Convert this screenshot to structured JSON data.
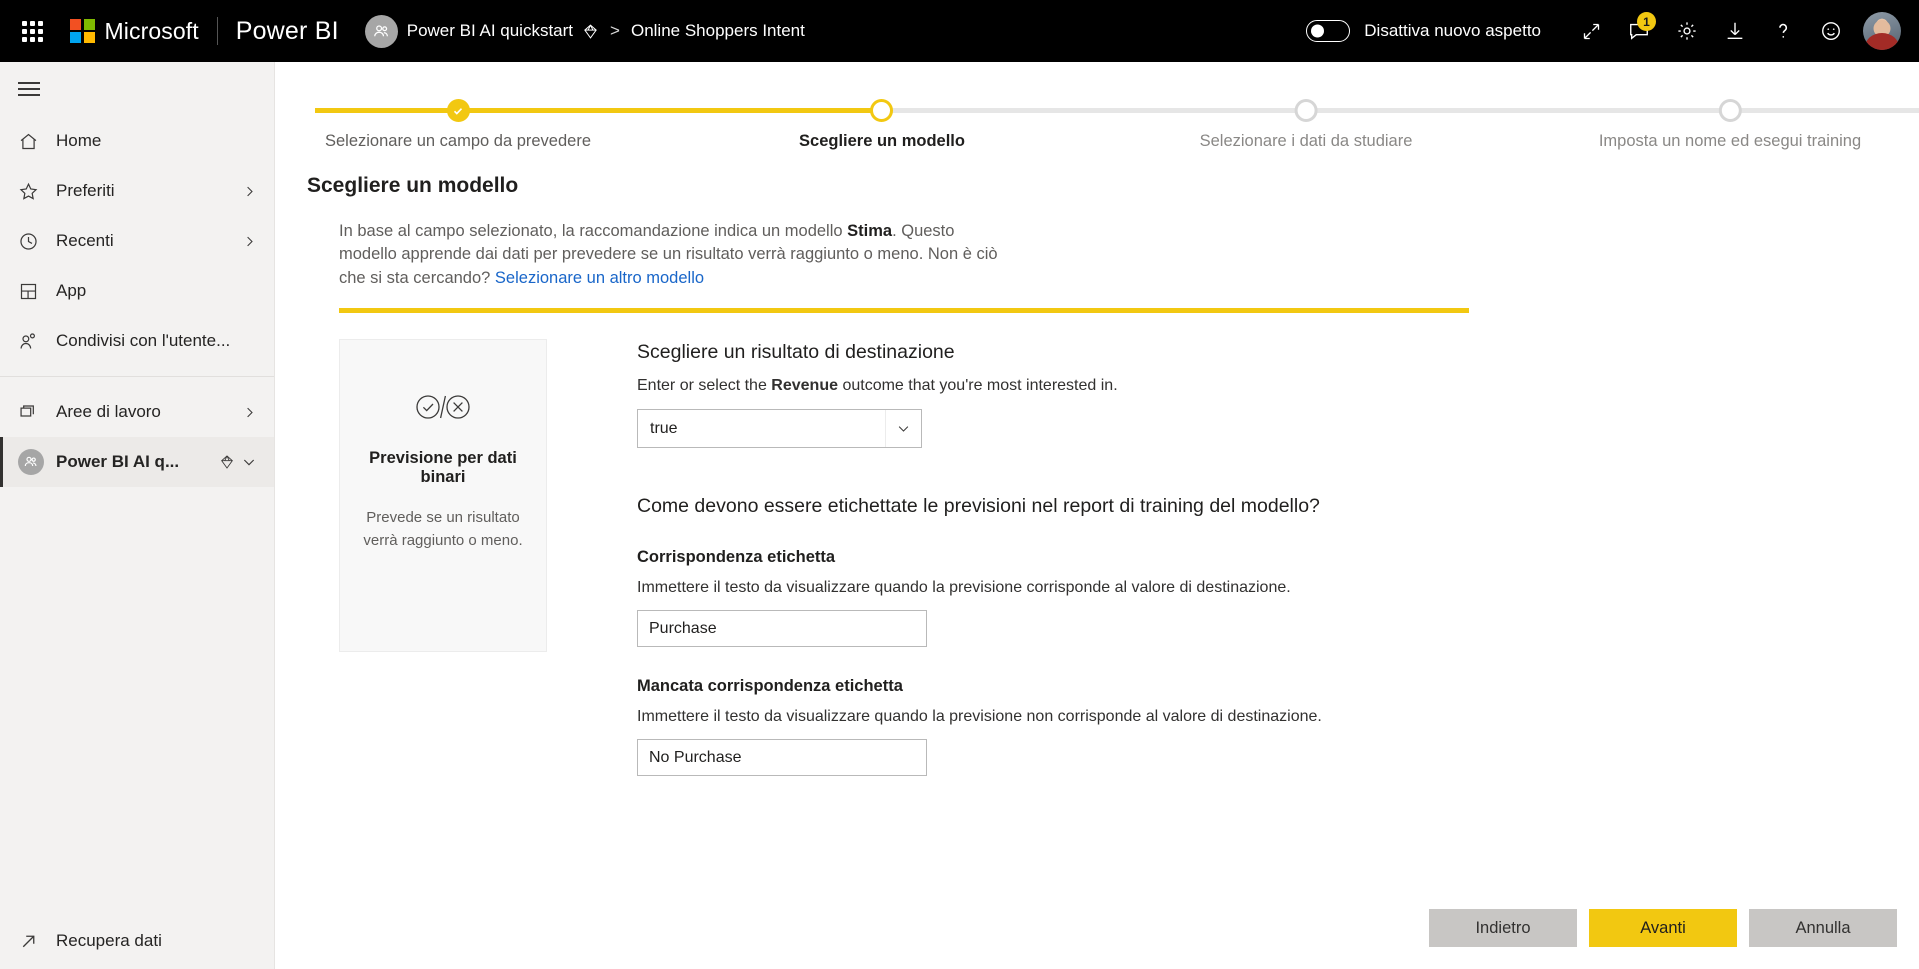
{
  "topbar": {
    "waffle_title": "app-launcher",
    "microsoft_label": "Microsoft",
    "product_label": "Power BI",
    "breadcrumb": {
      "workspace": "Power BI AI quickstart",
      "separator": ">",
      "item": "Online Shoppers Intent"
    },
    "new_look_toggle": {
      "label": "Disattiva nuovo aspetto",
      "state": "off"
    },
    "icons": [
      {
        "name": "expand-icon",
        "glyph": "expand"
      },
      {
        "name": "notifications-icon",
        "glyph": "comment",
        "badge": "1"
      },
      {
        "name": "settings-icon",
        "glyph": "gear"
      },
      {
        "name": "download-icon",
        "glyph": "download"
      },
      {
        "name": "help-icon",
        "glyph": "question"
      },
      {
        "name": "feedback-icon",
        "glyph": "smiley"
      }
    ]
  },
  "sidebar": {
    "hamburger": "navigation-menu",
    "items": [
      {
        "label": "Home",
        "icon": "home-icon",
        "chevron": false
      },
      {
        "label": "Preferiti",
        "icon": "star-icon",
        "chevron": true
      },
      {
        "label": "Recenti",
        "icon": "clock-icon",
        "chevron": true
      },
      {
        "label": "App",
        "icon": "apps-icon",
        "chevron": false
      },
      {
        "label": "Condivisi con l'utente...",
        "icon": "shared-user-icon",
        "chevron": false
      }
    ],
    "workspaces_label": "Aree di lavoro",
    "workspaces_icon": "workspaces-icon",
    "selected_workspace": {
      "label": "Power BI AI q...",
      "premium_icon": "diamond-icon",
      "chevron_icon": "chevron-down-icon"
    },
    "bottom_item": {
      "label": "Recupera dati",
      "icon": "arrow-up-right-icon"
    }
  },
  "wizard": {
    "steps": [
      {
        "label": "Selezionare un campo da prevedere",
        "state": "done"
      },
      {
        "label": "Scegliere un modello",
        "state": "current"
      },
      {
        "label": "Selezionare i dati da studiare",
        "state": "todo"
      },
      {
        "label": "Imposta un nome ed esegui training",
        "state": "todo"
      }
    ]
  },
  "page": {
    "title": "Scegliere un modello",
    "intro": {
      "part1": "In base al campo selezionato, la raccomandazione indica un modello ",
      "bold": "Stima",
      "part2": ". Questo modello apprende dai dati per prevedere se un risultato verrà raggiunto o meno. Non è ciò che si sta cercando? ",
      "link": "Selezionare un altro modello"
    }
  },
  "model_card": {
    "icon": "binary-prediction-icon",
    "title": "Previsione per dati binari",
    "description": "Prevede se un risultato verrà raggiunto o meno."
  },
  "outcome_section": {
    "heading": "Scegliere un risultato di destinazione",
    "helper_part1": "Enter or select the ",
    "helper_bold": "Revenue",
    "helper_part2": " outcome that you're most interested in.",
    "dropdown": {
      "name": "target-outcome-dropdown",
      "value": "true",
      "chevron": "chevron-down-icon",
      "options": [
        "true",
        "false"
      ]
    }
  },
  "labels_section": {
    "heading": "Come devono essere etichettate le previsioni nel report di training del modello?",
    "fields": [
      {
        "label": "Corrispondenza etichetta",
        "description": "Immettere il testo da visualizzare quando la previsione corrisponde al valore di destinazione.",
        "value": "Purchase",
        "placeholder": ""
      },
      {
        "label": "Mancata corrispondenza etichetta",
        "description": "Immettere il testo da visualizzare quando la previsione non corrisponde al valore di destinazione.",
        "value": "No Purchase",
        "placeholder": ""
      }
    ]
  },
  "footer": {
    "back_label": "Indietro",
    "next_label": "Avanti",
    "cancel_label": "Annulla"
  },
  "colors": {
    "brand_yellow": "#F2C811",
    "topbar_black": "#000000",
    "sidebar_grey": "#f3f2f1",
    "link_blue": "#1966c9"
  }
}
